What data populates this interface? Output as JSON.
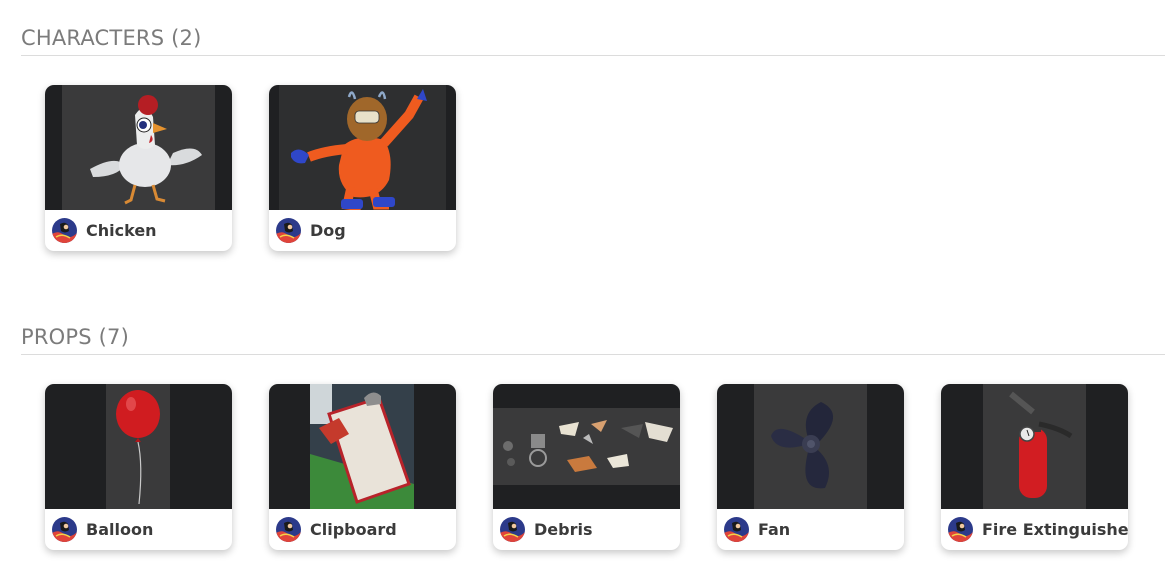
{
  "sections": [
    {
      "title": "CHARACTERS (2)",
      "items": [
        {
          "label": "Chicken"
        },
        {
          "label": "Dog"
        }
      ]
    },
    {
      "title": "PROPS (7)",
      "items": [
        {
          "label": "Balloon"
        },
        {
          "label": "Clipboard"
        },
        {
          "label": "Debris"
        },
        {
          "label": "Fan"
        },
        {
          "label": "Fire Extinguisher"
        }
      ]
    }
  ],
  "colors": {
    "thumb_dark": "#1f2022",
    "thumb_inner": "#3a3a3b",
    "title_gray": "#7b7b7b",
    "label_text": "#3b3b3b",
    "avatar_blue": "#2c3a8a",
    "avatar_red": "#e0443a"
  }
}
